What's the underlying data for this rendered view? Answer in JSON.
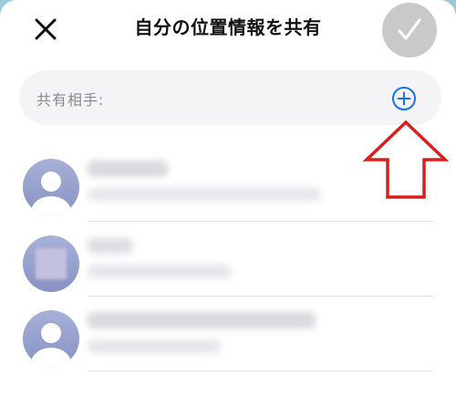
{
  "header": {
    "title": "自分の位置情報を共有",
    "close_icon": "close-icon",
    "done_icon": "checkmark-icon"
  },
  "recipient": {
    "label": "共有相手:",
    "add_icon": "plus-circle-icon"
  },
  "annotation": {
    "arrow_icon": "arrow-up-icon",
    "arrow_color": "#d91e1e"
  },
  "contacts": [
    {
      "avatar": "person-silhouette-icon",
      "name": "",
      "detail": ""
    },
    {
      "avatar": "contact-photo",
      "name": "",
      "detail": ""
    },
    {
      "avatar": "person-silhouette-icon",
      "name": "",
      "detail": ""
    }
  ],
  "colors": {
    "accent": "#1a73e8",
    "done_disabled": "#c9c9c9",
    "field_bg": "#f4f4f6"
  }
}
